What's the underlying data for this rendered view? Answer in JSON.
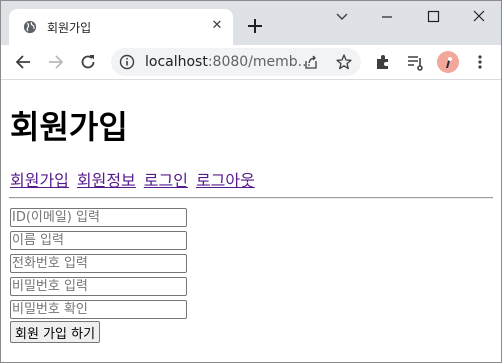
{
  "browser": {
    "tab_title": "회원가입",
    "tab_close_glyph": "✕",
    "url_host": "localhost",
    "url_path": ":8080/memb...",
    "theme_colors": {
      "tabbar": "#dee1e6",
      "omnibox": "#f1f3f4",
      "avatar": "#f2a79a"
    }
  },
  "page": {
    "title": "회원가입",
    "nav_links": [
      {
        "label": "회원가입"
      },
      {
        "label": "회원정보"
      },
      {
        "label": "로그인"
      },
      {
        "label": "로그아웃"
      }
    ],
    "link_color": "#551a8b",
    "form": {
      "fields": [
        {
          "placeholder": "ID(이메일) 입력",
          "value": ""
        },
        {
          "placeholder": "이름 입력",
          "value": ""
        },
        {
          "placeholder": "전화번호 입력",
          "value": ""
        },
        {
          "placeholder": "비밀번호 입력",
          "value": ""
        },
        {
          "placeholder": "비밀번호 확인",
          "value": ""
        }
      ],
      "submit_label": "회원 가입 하기"
    }
  }
}
